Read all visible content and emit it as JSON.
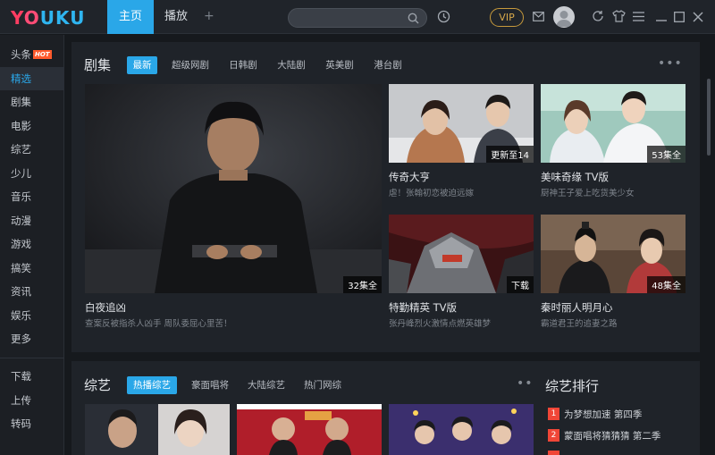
{
  "app": {
    "logo": {
      "y": "Y",
      "o": "O",
      "u": "U",
      "k": "K",
      "u2": "U"
    },
    "tabs": [
      {
        "label": "主页"
      },
      {
        "label": "播放"
      }
    ],
    "tab_add": "+",
    "search": {
      "placeholder": "",
      "value": ""
    },
    "vip_label": "VIP",
    "accent_color": "#2aa7e8"
  },
  "sidebar": {
    "items": [
      {
        "label": "头条",
        "badge": "HOT"
      },
      {
        "label": "精选"
      },
      {
        "label": "剧集"
      },
      {
        "label": "电影"
      },
      {
        "label": "综艺"
      },
      {
        "label": "少儿"
      },
      {
        "label": "音乐"
      },
      {
        "label": "动漫"
      },
      {
        "label": "游戏"
      },
      {
        "label": "搞笑"
      },
      {
        "label": "资讯"
      },
      {
        "label": "娱乐"
      },
      {
        "label": "更多"
      }
    ],
    "bottom_items": [
      {
        "label": "下载"
      },
      {
        "label": "上传"
      },
      {
        "label": "转码"
      }
    ]
  },
  "drama": {
    "title": "剧集",
    "chips": [
      "最新",
      "超级网剧",
      "日韩剧",
      "大陆剧",
      "英美剧",
      "港台剧"
    ],
    "more": "•••",
    "featured": {
      "title": "白夜追凶",
      "subtitle": "查案反被指杀人凶手 周队委屈心里苦！",
      "badge": "32集全"
    },
    "cards": [
      {
        "title": "传奇大亨",
        "subtitle": "虐！张翰初恋被迫远嫁",
        "badge": "更新至14"
      },
      {
        "title": "美味奇缘 TV版",
        "subtitle": "厨神王子爱上吃货美少女",
        "badge": "53集全"
      },
      {
        "title": "特勤精英 TV版",
        "subtitle": "张丹峰烈火激情点燃英雄梦",
        "badge": "下载"
      },
      {
        "title": "秦时丽人明月心",
        "subtitle": "霸道君王的追妻之路",
        "badge": "48集全"
      }
    ]
  },
  "variety": {
    "title": "综艺",
    "chips": [
      "热播综艺",
      "豪面唱将",
      "大陆综艺",
      "热门网综"
    ],
    "more": "•••"
  },
  "ranking": {
    "title": "综艺排行",
    "items": [
      {
        "rank": "1",
        "label": "为梦想加速 第四季"
      },
      {
        "rank": "2",
        "label": "蒙面唱将猜猜猜 第二季"
      }
    ]
  }
}
